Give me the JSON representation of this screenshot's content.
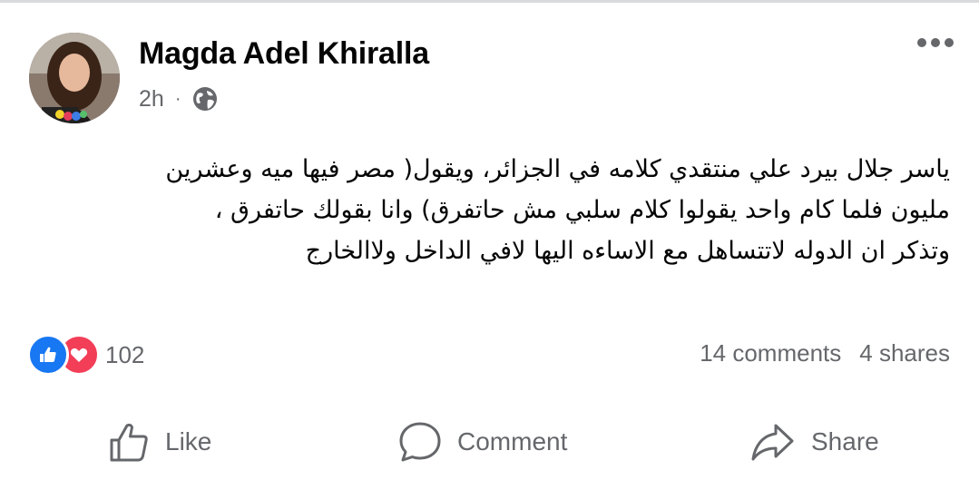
{
  "post": {
    "author": "Magda Adel Khiralla",
    "time": "2h",
    "separator": "·",
    "privacy_icon": "globe-icon",
    "text_lines": [
      "ياسر جلال بيرد علي منتقدي كلامه في الجزائر، ويقول( مصر فيها ميه وعشرين",
      "مليون فلما كام واحد يقولوا كلام سلبي مش حاتفرق) وانا بقولك حاتفرق ،",
      "وتذكر ان الدوله لاتتساهل مع الاساءه اليها لافي الداخل ولاالخارج"
    ]
  },
  "engagement": {
    "reaction_icons": [
      "like-reaction-icon",
      "love-reaction-icon"
    ],
    "reaction_count": "102",
    "comments": "14 comments",
    "shares": "4 shares"
  },
  "actions": {
    "like": "Like",
    "comment": "Comment",
    "share": "Share"
  },
  "colors": {
    "like_blue": "#1877f2",
    "love_red": "#f33e58",
    "secondary_text": "#65676b",
    "primary_text": "#050505"
  }
}
